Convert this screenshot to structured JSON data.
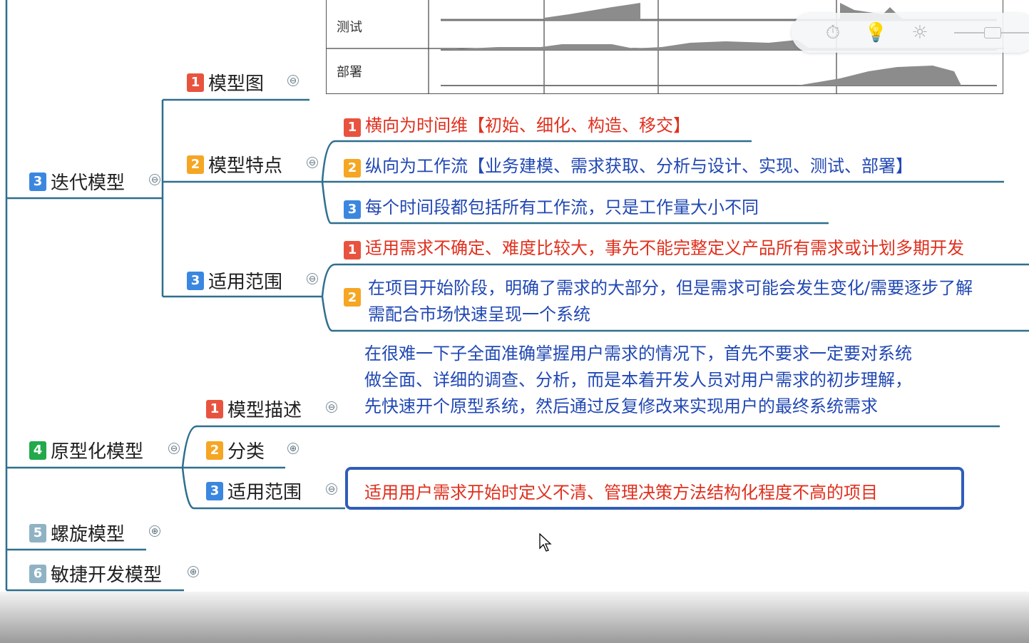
{
  "branches": {
    "iterative": {
      "badge": "3",
      "label": "迭代模型",
      "model_image": {
        "badge": "1",
        "label": "模型图",
        "rows": [
          "测试",
          "部署"
        ]
      },
      "features": {
        "badge": "2",
        "label": "模型特点",
        "items": [
          {
            "badge": "1",
            "text": "横向为时间维【初始、细化、构造、移交】"
          },
          {
            "badge": "2",
            "text": "纵向为工作流【业务建模、需求获取、分析与设计、实现、测试、部署】"
          },
          {
            "badge": "3",
            "text": "每个时间段都包括所有工作流，只是工作量大小不同"
          }
        ]
      },
      "scope": {
        "badge": "3",
        "label": "适用范围",
        "items": [
          {
            "badge": "1",
            "text": "适用需求不确定、难度比较大，事先不能完整定义产品所有需求或计划多期开发"
          },
          {
            "badge": "2",
            "line1": "在项目开始阶段，明确了需求的大部分，但是需求可能会发生变化/需要逐步了解",
            "line2": "需配合市场快速呈现一个系统"
          }
        ]
      }
    },
    "prototype": {
      "badge": "4",
      "label": "原型化模型",
      "description": {
        "badge": "1",
        "label": "模型描述",
        "lines": [
          "在很难一下子全面准确掌握用户需求的情况下，首先不要求一定要对系统",
          "做全面、详细的调查、分析，而是本着开发人员对用户需求的初步理解，",
          "先快速开个原型系统，然后通过反复修改来实现用户的最终系统需求"
        ]
      },
      "category": {
        "badge": "2",
        "label": "分类"
      },
      "scope": {
        "badge": "3",
        "label": "适用范围",
        "text": "适用用户需求开始时定义不清、管理决策方法结构化程度不高的项目"
      }
    },
    "spiral": {
      "badge": "5",
      "label": "螺旋模型"
    },
    "agile": {
      "badge": "6",
      "label": "敏捷开发模型"
    }
  },
  "toggles": {
    "collapse": "⊖",
    "expand": "⊕"
  },
  "toolbar": {
    "icons": [
      "timer-icon",
      "lightbulb-icon",
      "brightness-icon",
      "zoom-slider"
    ]
  },
  "colors": {
    "line": "#2e6f8e",
    "selection": "#2f5db8",
    "red_text": "#e0301e",
    "blue_text": "#2148b3"
  }
}
